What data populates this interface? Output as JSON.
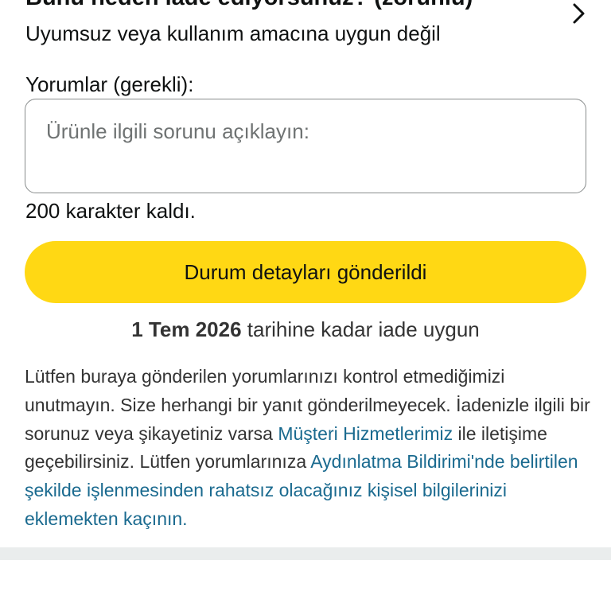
{
  "reason": {
    "heading": "Bunu neden iade ediyorsunuz? (zorunlu)",
    "value": "Uyumsuz veya kullanım amacına uygun değil",
    "chevron_icon": "chevron-right-icon"
  },
  "comments": {
    "label": "Yorumlar (gerekli):",
    "value": "",
    "placeholder": "Ürünle ilgili sorunu açıklayın:",
    "remaining": "200 karakter kaldı."
  },
  "submit": {
    "label": "Durum detayları gönderildi",
    "color": "#FFD814"
  },
  "eligibility": {
    "date": "1 Tem 2026",
    "suffix": " tarihine kadar iade uygun"
  },
  "notice": {
    "part1": "Lütfen buraya gönderilen yorumlarınızı kontrol etmediğimizi unutmayın. Size herhangi bir yanıt gönderilmeyecek. İadenizle ilgili bir sorunuz veya şikayetiniz varsa ",
    "customer_service_link": "Müşteri Hizmetlerimiz",
    "part2": " ile iletişime geçebilirsiniz. Lütfen yorumlarınıza ",
    "privacy_link": "Aydınlatma Bildirimi'nde belirtilen şekilde işlenmesinden rahatsız olacağınız kişisel bilgilerinizi eklemekten kaçının.",
    "link_color": "#1A6A8F"
  }
}
